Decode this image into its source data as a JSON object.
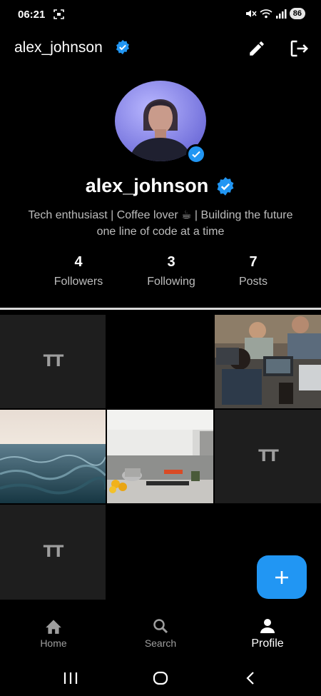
{
  "status_bar": {
    "time": "06:21",
    "battery": "86",
    "icons": [
      "screenshot-icon",
      "mute-icon",
      "wifi-icon",
      "signal-icon"
    ]
  },
  "header": {
    "username": "alex_johnson",
    "icons": [
      "verified-icon",
      "edit-icon",
      "logout-icon"
    ]
  },
  "profile": {
    "name": "alex_johnson",
    "bio": "Tech enthusiast | Coffee lover ☕ | Building the future one line of code at a time",
    "stats": [
      {
        "value": "4",
        "label": "Followers"
      },
      {
        "value": "3",
        "label": "Following"
      },
      {
        "value": "7",
        "label": "Posts"
      }
    ]
  },
  "grid": {
    "text_post_glyph": "TT",
    "posts": [
      "text-post",
      "empty-post",
      "photo-team-laptops",
      "photo-ocean-wave",
      "photo-kitchen",
      "text-post",
      "text-post"
    ]
  },
  "fab": {
    "icon": "plus-icon"
  },
  "bottom_nav": {
    "items": [
      {
        "label": "Home",
        "icon": "home-icon"
      },
      {
        "label": "Search",
        "icon": "search-icon"
      },
      {
        "label": "Profile",
        "icon": "person-icon"
      }
    ],
    "active": "Profile"
  },
  "colors": {
    "accent": "#2196f3",
    "background": "#000000",
    "tile": "#1e1e1e",
    "muted_text": "#bdbdbd"
  }
}
